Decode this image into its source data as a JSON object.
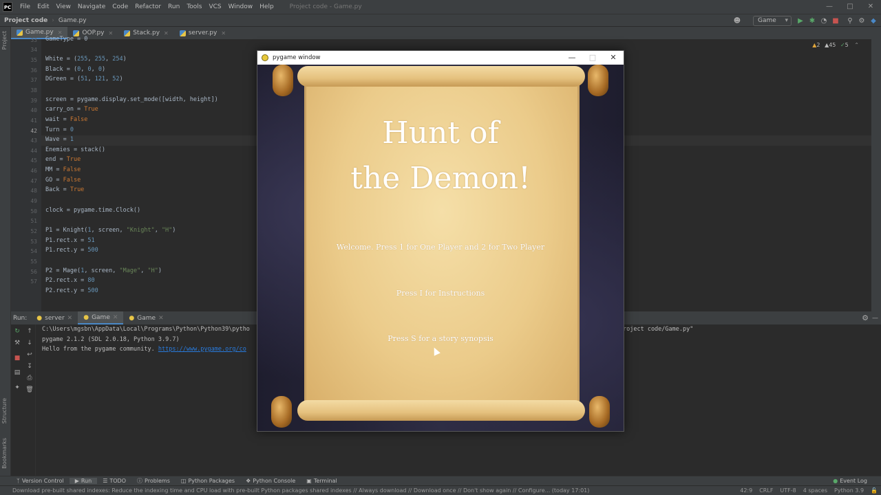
{
  "menubar": {
    "items": [
      "File",
      "Edit",
      "View",
      "Navigate",
      "Code",
      "Refactor",
      "Run",
      "Tools",
      "VCS",
      "Window",
      "Help"
    ],
    "project_title": "Project code - Game.py"
  },
  "navbar": {
    "project": "Project code",
    "file": "Game.py",
    "run_config": "Game"
  },
  "tabs": [
    "Game.py",
    "OOP.py",
    "Stack.py",
    "server.py"
  ],
  "inspections": {
    "warnings": "2",
    "weak_warnings": "45",
    "ok": "5"
  },
  "gutter": [
    "33",
    "34",
    "35",
    "36",
    "37",
    "38",
    "39",
    "40",
    "41",
    "42",
    "43",
    "44",
    "45",
    "46",
    "47",
    "48",
    "49",
    "50",
    "51",
    "52",
    "53",
    "54",
    "55",
    "56",
    "57"
  ],
  "code_lines": [
    "GameType = 0",
    "",
    "White = (255, 255, 254)",
    "Black = (0, 0, 0)",
    "DGreen = (51, 121, 52)",
    "",
    "screen = pygame.display.set_mode([width, height])",
    "carry_on = True",
    "wait = False",
    "Turn = 0",
    "Wave = 1",
    "Enemies = stack()",
    "end = True",
    "MM = False",
    "GO = False",
    "Back = True",
    "",
    "clock = pygame.time.Clock()",
    "",
    "P1 = Knight(1, screen, \"Knight\", \"H\")",
    "P1.rect.x = 51",
    "P1.rect.y = 500",
    "",
    "P2 = Mage(1, screen, \"Mage\", \"H\")",
    "P2.rect.x = 80",
    "P2.rect.y = 500"
  ],
  "run_panel": {
    "label": "Run:",
    "tabs": [
      "server",
      "Game",
      "Game"
    ],
    "console": [
      "C:\\Users\\mgsbn\\AppData\\Local\\Programs\\Python\\Python39\\pytho",
      "pygame 2.1.2 (SDL 2.0.18, Python 3.9.7)",
      "Hello from the pygame community. "
    ],
    "console_link": "https://www.pygame.org/co",
    "console_tail": "roject code/Game.py\""
  },
  "left_strip": {
    "project": "Project",
    "structure": "Structure",
    "bookmarks": "Bookmarks"
  },
  "bottom_tabs": [
    "Version Control",
    "Run",
    "TODO",
    "Problems",
    "Python Packages",
    "Python Console",
    "Terminal"
  ],
  "event_log": "Event Log",
  "status": {
    "message": "Download pre-built shared indexes: Reduce the indexing time and CPU load with pre-built Python packages shared indexes // Always download // Download once // Don't show again // Configure... (today 17:01)",
    "position": "42:9",
    "line_sep": "CRLF",
    "encoding": "UTF-8",
    "indent": "4 spaces",
    "interpreter": "Python 3.9"
  },
  "pygame_window": {
    "title": "pygame window",
    "heading_line1": "Hunt of",
    "heading_line2": "the Demon!",
    "welcome": "Welcome. Press 1 for One Player and 2 for Two Player",
    "instructions": "Press I for Instructions",
    "synopsis": "Press S for a story synopsis"
  },
  "colors": {
    "ide_bg": "#2b2b2b",
    "keyword": "#cc7832",
    "number": "#6897bb",
    "string": "#6a8759",
    "parchment": "#ebcb8a"
  }
}
